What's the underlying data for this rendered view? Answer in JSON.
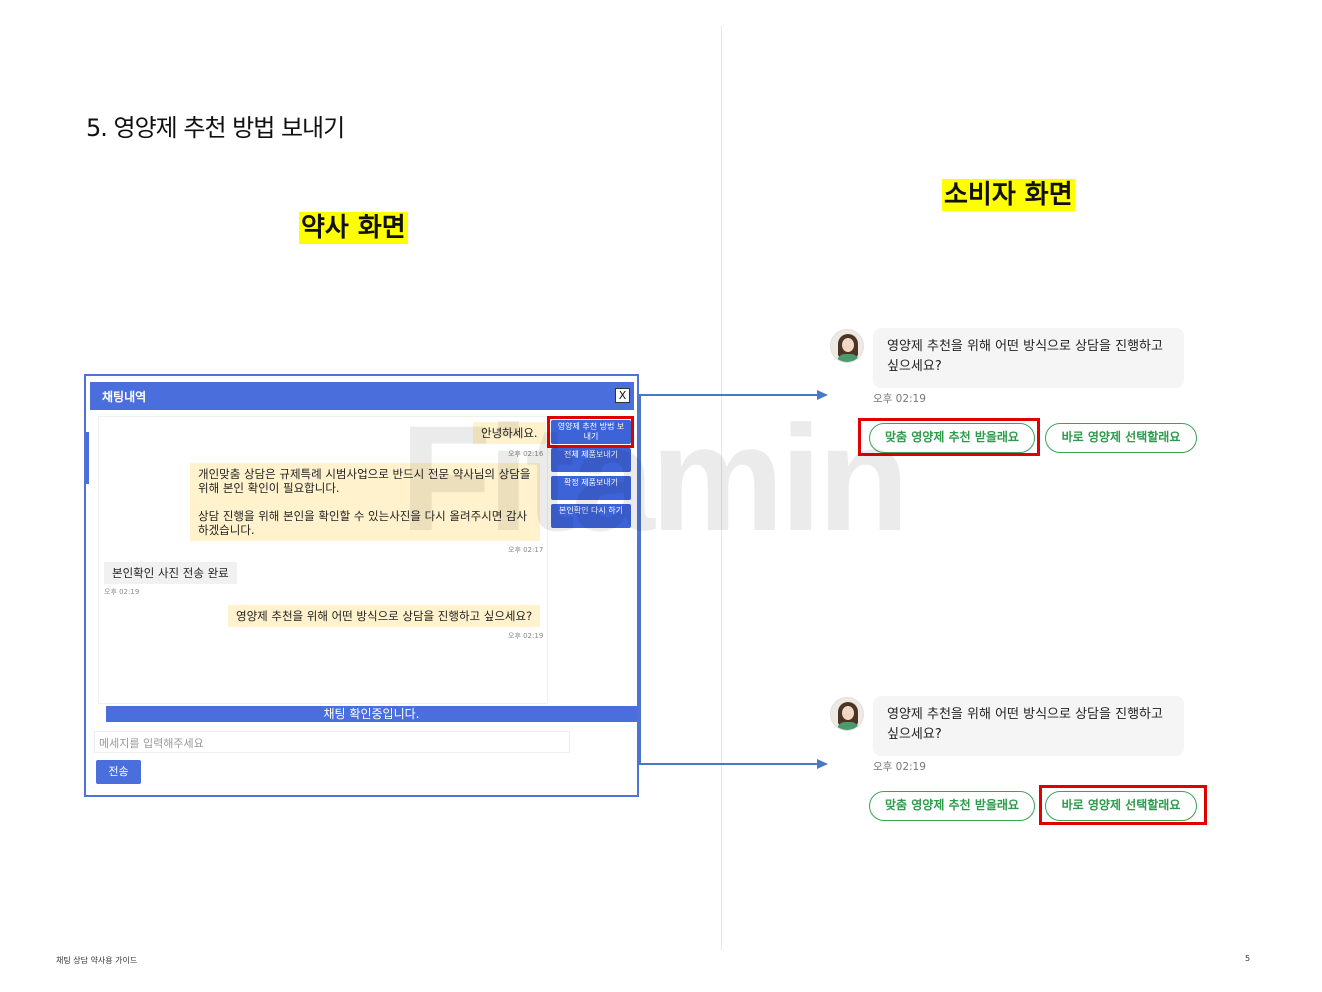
{
  "page": {
    "title": "5. 영양제 추천 방법 보내기",
    "pharmacist_label": "약사 화면",
    "consumer_label": "소비자 화면",
    "watermark": "Fitamin",
    "footer_left": "채팅 상담 약사용 가이드",
    "page_number": "5"
  },
  "pharmacist_chat": {
    "header_title": "채팅내역",
    "close_label": "X",
    "messages": [
      {
        "text": "안녕하세요.",
        "time": "오후 02:16",
        "direction": "out"
      },
      {
        "text": "개인맞춤 상담은 규제특례 시범사업으로 반드시 전문 약사님의 상담을 위해 본인 확인이 필요합니다.\n\n상담 진행을 위해 본인을 확인할 수 있는사진을 다시 올려주시면 감사하겠습니다.",
        "time": "오후 02:17",
        "direction": "out"
      },
      {
        "text": "본인확인 사진 전송 완료",
        "time": "오후 02:19",
        "direction": "in"
      },
      {
        "text": "영양제 추천을 위해 어떤 방식으로 상담을 진행하고 싶으세요?",
        "time": "오후 02:19",
        "direction": "out"
      }
    ],
    "side_buttons": [
      "영양제 추천 방법 보내기",
      "전체 제품보내기",
      "확정 제품보내기",
      "본인확인 다시 하기"
    ],
    "status_text": "채팅 확인중입니다.",
    "input_placeholder": "메세지를 입력해주세요",
    "send_label": "전송"
  },
  "consumer_views": [
    {
      "message": "영양제 추천을 위해 어떤 방식으로 상담을 진행하고 싶으세요?",
      "time": "오후 02:19",
      "option_1": "맞춤 영양제 추천 받을래요",
      "option_2": "바로 영양제 선택할래요",
      "highlighted": "option_1"
    },
    {
      "message": "영양제 추천을 위해 어떤 방식으로 상담을 진행하고 싶으세요?",
      "time": "오후 02:19",
      "option_1": "맞춤 영양제 추천 받을래요",
      "option_2": "바로 영양제 선택할래요",
      "highlighted": "option_2"
    }
  ],
  "colors": {
    "highlight": "#ffff00",
    "chat_blue": "#4a6fdc",
    "outgoing_bubble": "#fff2cc",
    "emphasis_red": "#e00000",
    "option_green": "#2e9a4c"
  }
}
